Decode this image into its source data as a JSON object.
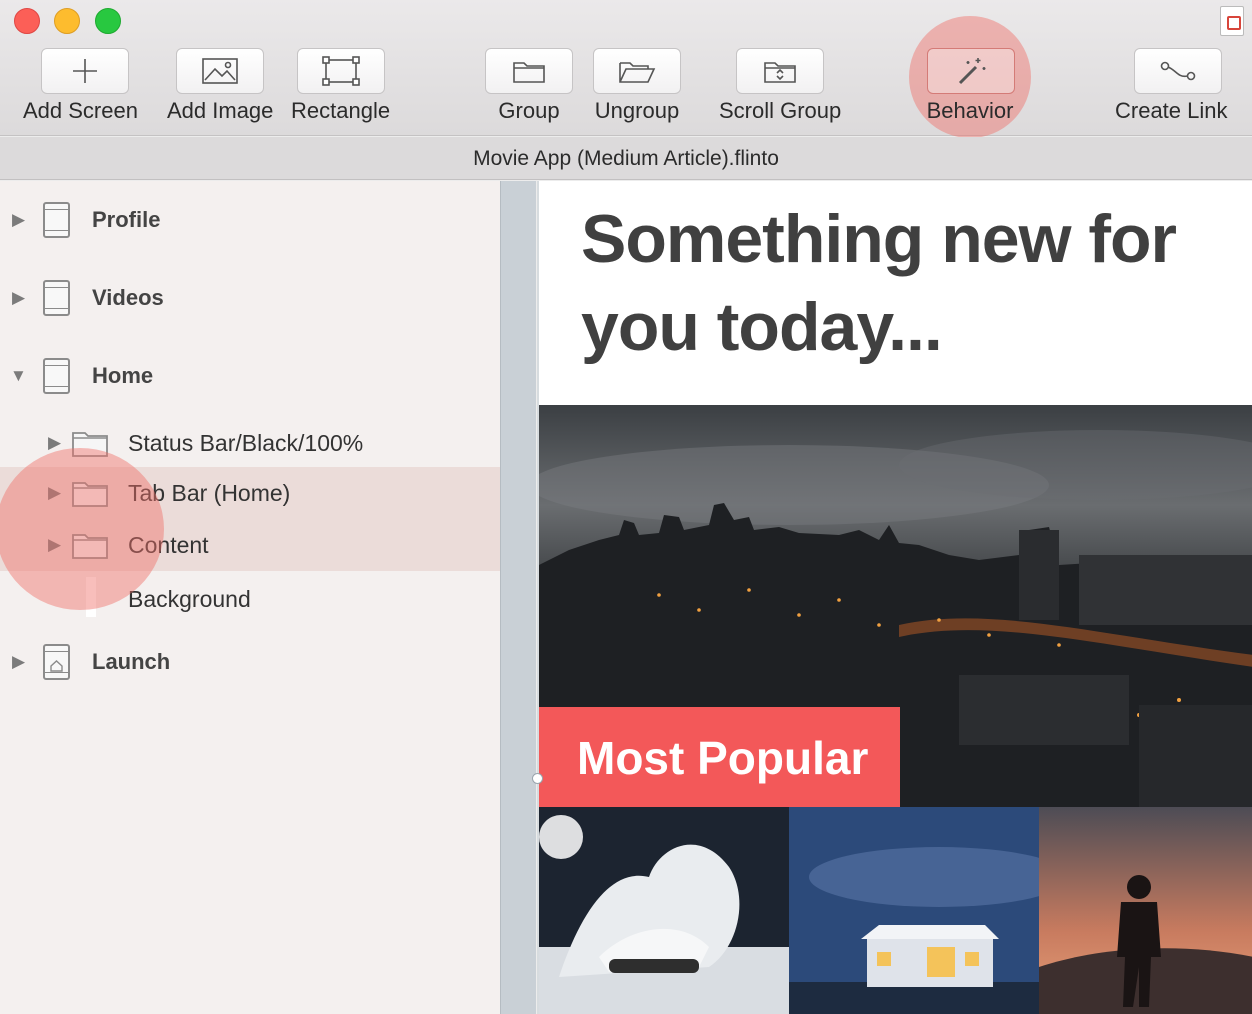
{
  "window": {
    "file_title": "Movie App (Medium Article).flinto"
  },
  "toolbar": {
    "add_screen": "Add Screen",
    "add_image": "Add Image",
    "rectangle": "Rectangle",
    "group": "Group",
    "ungroup": "Ungroup",
    "scroll_group": "Scroll Group",
    "behavior": "Behavior",
    "create_link": "Create Link"
  },
  "sidebar": {
    "items": [
      {
        "label": "Profile",
        "type": "screen",
        "expanded": false
      },
      {
        "label": "Videos",
        "type": "screen",
        "expanded": false
      },
      {
        "label": "Home",
        "type": "screen",
        "expanded": true
      },
      {
        "label": "Status Bar/Black/100%",
        "type": "group",
        "expanded": false
      },
      {
        "label": "Tab Bar (Home)",
        "type": "group",
        "expanded": false,
        "selected": true
      },
      {
        "label": "Content",
        "type": "group",
        "expanded": false,
        "selected": true
      },
      {
        "label": "Background",
        "type": "layer"
      },
      {
        "label": "Launch",
        "type": "screen-home",
        "expanded": false
      }
    ]
  },
  "canvas": {
    "headline": "Something new for you today...",
    "badge": "Most Popular"
  },
  "colors": {
    "accent_red": "#f35859",
    "highlight": "#f06e69",
    "selection": "#ebdcd9"
  }
}
